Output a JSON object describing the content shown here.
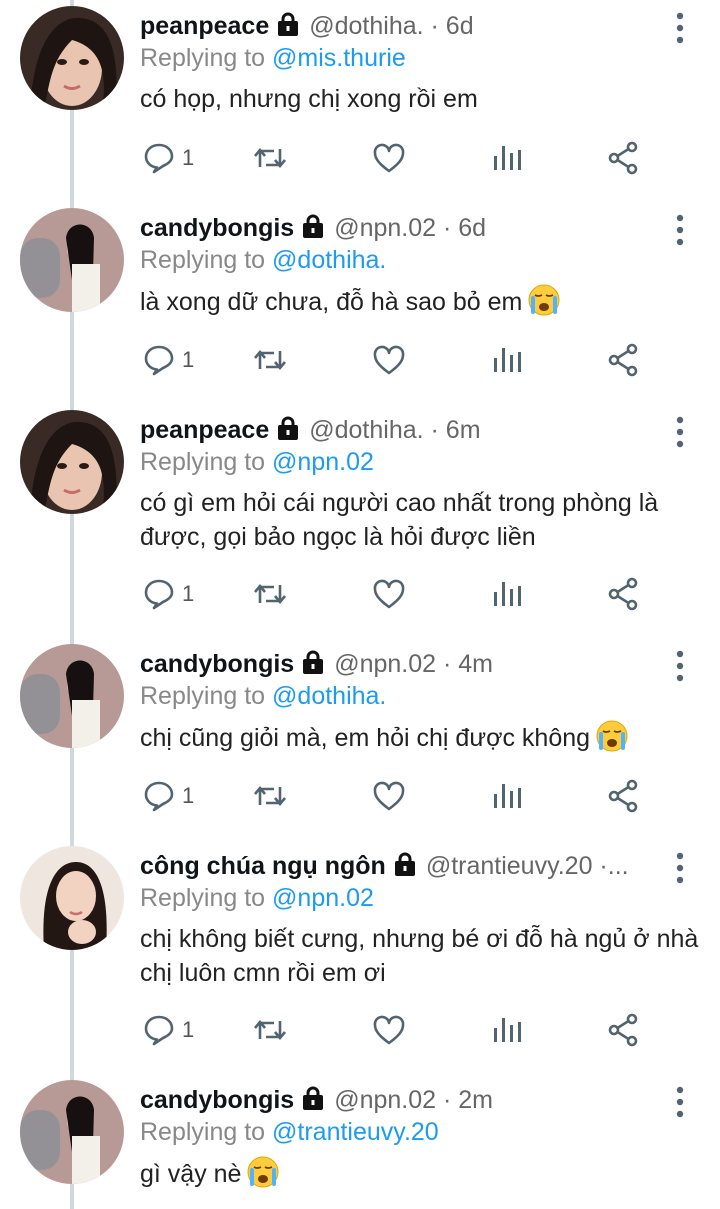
{
  "tweets": [
    {
      "name": "peanpeace",
      "meta": "@dothiha. · 6d",
      "replying_prefix": "Replying to ",
      "replying_to": "@mis.thurie",
      "text": "có họp, nhưng chị xong rồi em",
      "emoji": "",
      "reply_count": "1",
      "avatar": "woman-portrait-1"
    },
    {
      "name": "candybongis",
      "meta": "@npn.02 · 6d",
      "replying_prefix": "Replying to ",
      "replying_to": "@dothiha.",
      "text": "là xong dữ chưa, đỗ hà sao bỏ em",
      "emoji": "crying-face",
      "reply_count": "1",
      "avatar": "woman-portrait-2"
    },
    {
      "name": "peanpeace",
      "meta": "@dothiha. · 6m",
      "replying_prefix": "Replying to ",
      "replying_to": "@npn.02",
      "text": "có gì em hỏi cái người cao nhất trong phòng là được, gọi bảo ngọc là hỏi được liền",
      "emoji": "",
      "reply_count": "1",
      "avatar": "woman-portrait-1"
    },
    {
      "name": "candybongis",
      "meta": "@npn.02 · 4m",
      "replying_prefix": "Replying to ",
      "replying_to": "@dothiha.",
      "text": "chị cũng giỏi mà, em hỏi chị được không",
      "emoji": "crying-face",
      "reply_count": "1",
      "avatar": "woman-portrait-2"
    },
    {
      "name": "công chúa ngụ ngôn",
      "meta": "@trantieuvy.20 ·...",
      "replying_prefix": "Replying to ",
      "replying_to": "@npn.02",
      "text": "chị không biết cưng, nhưng bé ơi đỗ hà ngủ ở nhà chị luôn cmn rồi em ơi",
      "emoji": "",
      "reply_count": "1",
      "avatar": "woman-portrait-3"
    },
    {
      "name": "candybongis",
      "meta": "@npn.02 · 2m",
      "replying_prefix": "Replying to ",
      "replying_to": "@trantieuvy.20",
      "text": "gì vậy nè",
      "emoji": "crying-face",
      "reply_count": "",
      "avatar": "woman-portrait-2"
    }
  ],
  "colors": {
    "link": "#1d9bf0",
    "icon": "#536471",
    "muted": "#888888",
    "thread_line": "#cfd9de"
  },
  "icons": [
    "lock-icon",
    "more-vertical-icon",
    "reply-icon",
    "retweet-icon",
    "like-icon",
    "analytics-icon",
    "share-icon"
  ]
}
